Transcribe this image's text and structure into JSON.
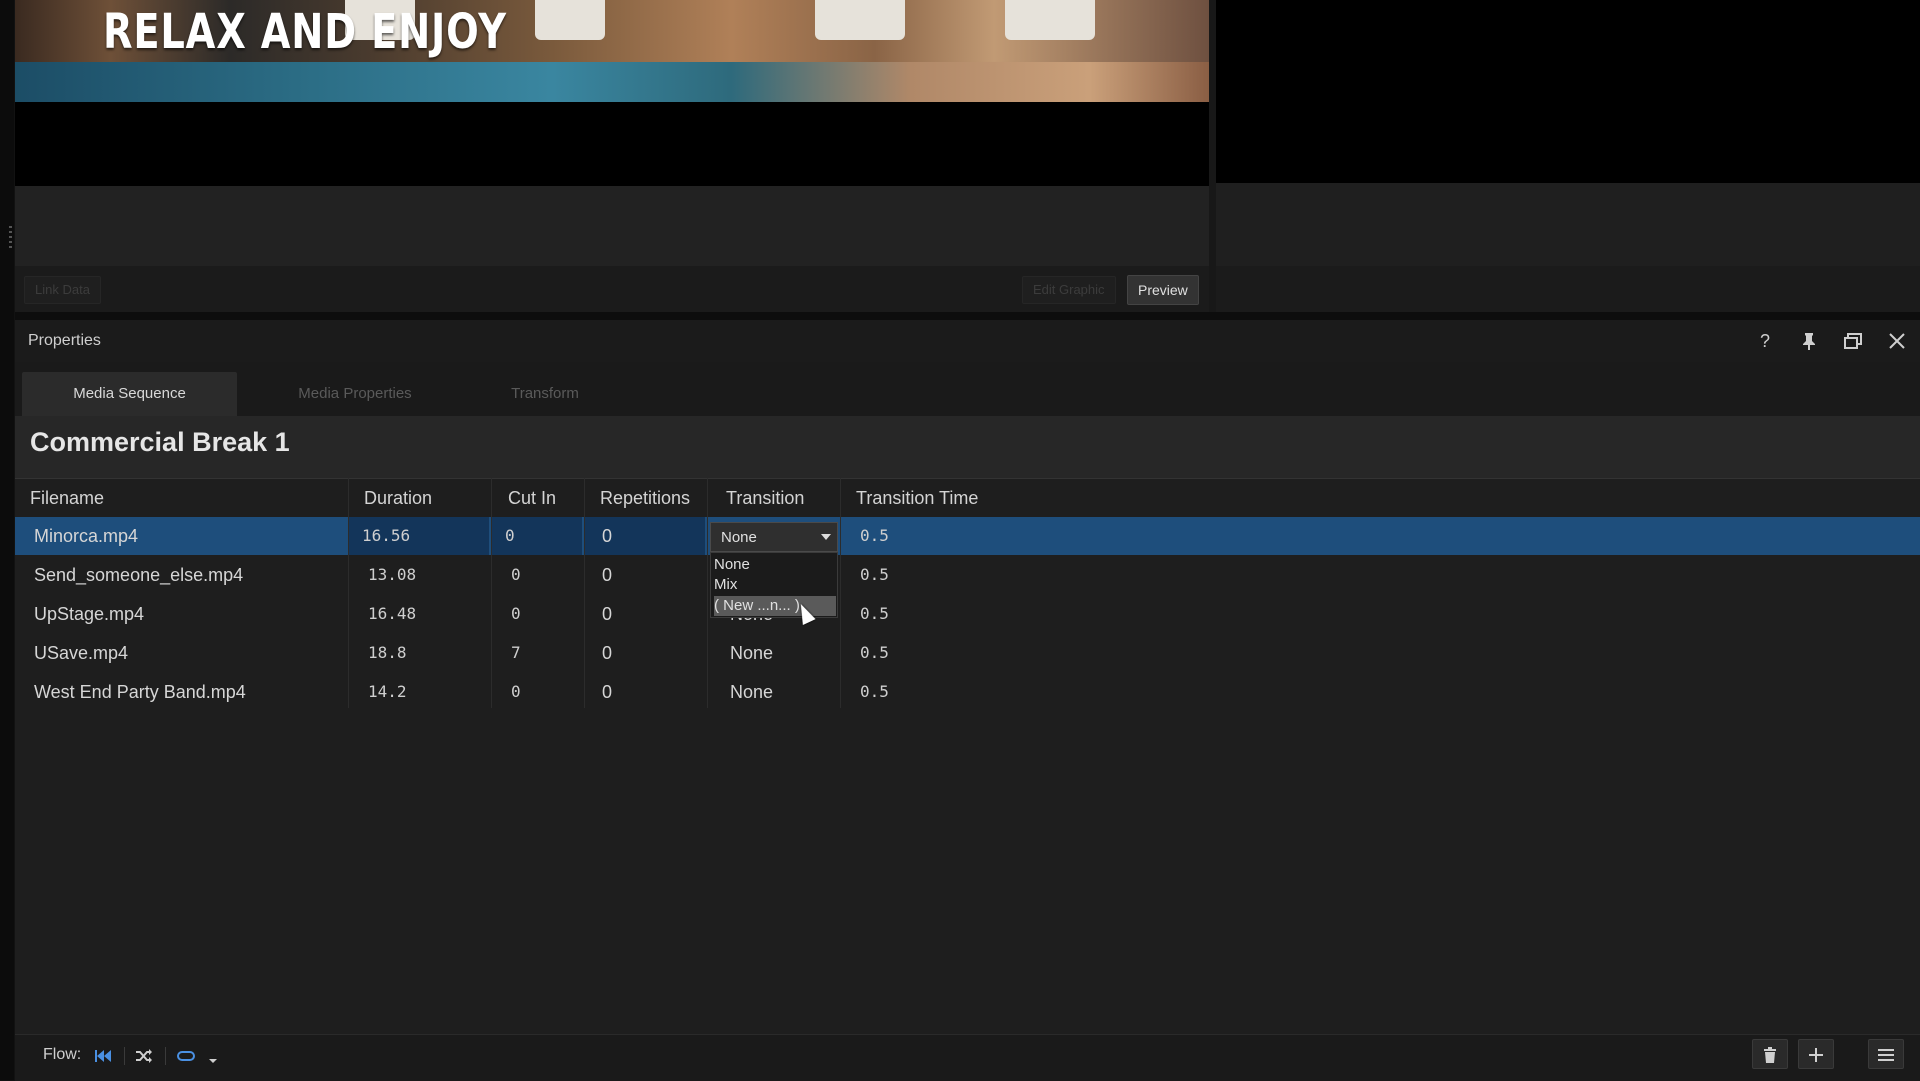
{
  "preview": {
    "overlay_text": "RELAX AND ENJOY",
    "link_data_label": "Link Data",
    "edit_graphic_label": "Edit Graphic",
    "preview_label": "Preview"
  },
  "panel": {
    "title": "Properties",
    "icons": [
      "help-icon",
      "pin-icon",
      "restore-window-icon",
      "close-icon"
    ]
  },
  "tabs": [
    {
      "label": "Media Sequence",
      "active": true
    },
    {
      "label": "Media Properties",
      "active": false
    },
    {
      "label": "Transform",
      "active": false
    }
  ],
  "sequence": {
    "title": "Commercial Break 1",
    "columns": [
      "Filename",
      "Duration",
      "Cut In",
      "Repetitions",
      "Transition",
      "Transition Time"
    ],
    "rows": [
      {
        "filename": "Minorca.mp4",
        "duration": "16.56",
        "cut_in": "0",
        "repetitions": "0",
        "transition": "None",
        "transition_time": "0.5",
        "selected": true
      },
      {
        "filename": "Send_someone_else.mp4",
        "duration": "13.08",
        "cut_in": "0",
        "repetitions": "0",
        "transition": "",
        "transition_time": "0.5",
        "selected": false
      },
      {
        "filename": "UpStage.mp4",
        "duration": "16.48",
        "cut_in": "0",
        "repetitions": "0",
        "transition": "None",
        "transition_time": "0.5",
        "selected": false
      },
      {
        "filename": "USave.mp4",
        "duration": "18.8",
        "cut_in": "7",
        "repetitions": "0",
        "transition": "None",
        "transition_time": "0.5",
        "selected": false
      },
      {
        "filename": "West End Party Band.mp4",
        "duration": "14.2",
        "cut_in": "0",
        "repetitions": "0",
        "transition": "None",
        "transition_time": "0.5",
        "selected": false
      }
    ]
  },
  "transition_dropdown": {
    "value": "None",
    "options": [
      "None",
      "Mix",
      "( New ...n... )"
    ],
    "highlighted": "( New ...n... )"
  },
  "footer": {
    "flow_label": "Flow:",
    "flow_icons": [
      "skip-to-start-icon",
      "shuffle-icon",
      "loop-icon",
      "dropdown-caret-icon"
    ],
    "actions": [
      "delete-icon",
      "add-icon",
      "menu-icon"
    ]
  },
  "colors": {
    "selection": "#1e4e7c",
    "accent_icon": "#4a90e2",
    "panel_bg": "#1e1e1e"
  }
}
